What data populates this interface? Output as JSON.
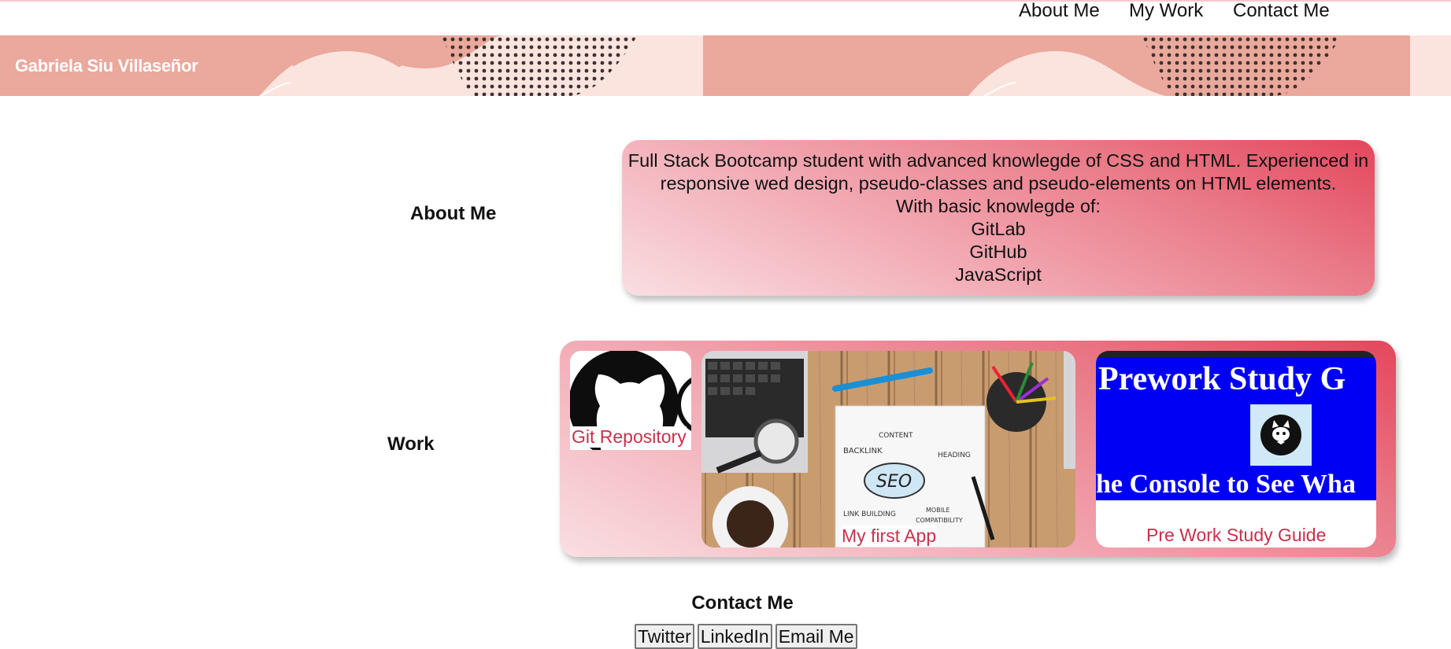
{
  "nav": {
    "items": [
      "About Me",
      "My Work",
      "Contact Me"
    ]
  },
  "header": {
    "brand": "Gabriela Siu Villaseñor"
  },
  "about": {
    "label": "About Me",
    "lines": [
      "Full Stack Bootcamp student with advanced knowlegde of CSS and HTML. Experienced in",
      "responsive wed design, pseudo-classes and pseudo-elements on HTML elements.",
      "With basic knowlegde of:",
      "GitLab",
      "GitHub",
      "JavaScript"
    ]
  },
  "work": {
    "label": "Work",
    "items": [
      {
        "caption": "Git Repository",
        "icon": "github-logo"
      },
      {
        "caption": "My first App",
        "icon": "seo-desk-photo"
      },
      {
        "caption": "Pre Work Study Guide",
        "icon": "prework-screenshot",
        "screenshot_title": "Prework Study G",
        "screenshot_subtitle": "he Console to See Wha"
      }
    ]
  },
  "contact": {
    "title": "Contact Me",
    "buttons": [
      "Twitter",
      "LinkedIn",
      "Email Me"
    ]
  },
  "colors": {
    "accent": "#e4465c",
    "caption": "#c8304c",
    "hero_band": "#eba89c",
    "hero_light": "#fbe3de"
  }
}
